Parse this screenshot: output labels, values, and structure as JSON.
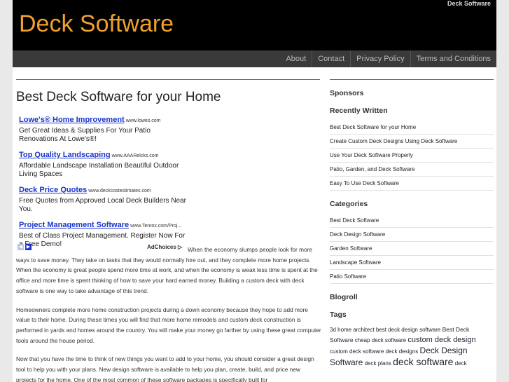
{
  "header": {
    "site_title": "Deck Software",
    "top_label": "Deck Software"
  },
  "nav": [
    "About",
    "Contact",
    "Privacy Policy",
    "Terms and Conditions"
  ],
  "post": {
    "title": "Best Deck Software for your Home"
  },
  "ads": [
    {
      "title": "Lowe's® Home Improvement",
      "url": "www.lowes.com",
      "desc": "Get Great Ideas & Supplies For Your Patio Renovations At Lowe's®!"
    },
    {
      "title": "Top Quality Landscaping",
      "url": "www.AAARelcks.com",
      "desc": "Affordable Landscape Installation Beautiful Outdoor Living Spaces"
    },
    {
      "title": "Deck Price Quotes",
      "url": "www.deckcostestimates.com",
      "desc": "Free Quotes from Approved Local Deck Builders Near You."
    },
    {
      "title": "Project Management Software",
      "url": "www.Tenrox.com/Proj...",
      "desc": "Best of Class Project Management. Register Now For a Free Demo!"
    }
  ],
  "adchoices": "AdChoices ▷",
  "paragraphs": [
    "When the economy slumps people look for more ways to save money. They take on tasks that they would normally hire out, and they complete more home projects. When the economy is great people spend more time at work, and when the economy is weak less time is spent at the office and more time is spent thinking of how to save your hard earned money. Building a custom deck with deck software is one way to take advantage of this trend.",
    "Homeowners complete more home construction projects during a down economy because they hope to add more value to their home. During these times you will find that more home remodels and custom deck construction is performed in yards and homes around the country. You will make your money go farther by using these great computer tools around the house period.",
    "Now that you have the time to think of new things you want to add to your home, you should consider a great design tool to help you with your plans. New design software is available to help you plan, create, build, and price new projects for the home. One of the most common of these software packages is specifically built for"
  ],
  "sidebar": {
    "sponsors_heading": "Sponsors",
    "recent_heading": "Recently Written",
    "recent": [
      "Best Deck Software for your Home",
      "Create Custom Deck Designs Using Deck Software",
      "Use Your Deck Software Properly",
      "Patio, Garden, and Deck Software",
      "Easy To Use Deck Software"
    ],
    "categories_heading": "Categories",
    "categories": [
      "Best Deck Software",
      "Deck Design Software",
      "Garden Software",
      "Landscape Software",
      "Patio Software"
    ],
    "blogroll_heading": "Blogroll",
    "tags_heading": "Tags",
    "tags": [
      {
        "label": "3d home architect",
        "size": "t8"
      },
      {
        "label": "best deck design software",
        "size": "t8"
      },
      {
        "label": "Best Deck Software",
        "size": "t9"
      },
      {
        "label": "cheap deck software",
        "size": "t8"
      },
      {
        "label": "custom deck design",
        "size": "t11"
      },
      {
        "label": "custom deck software",
        "size": "t8"
      },
      {
        "label": "deck designs",
        "size": "t8"
      },
      {
        "label": "Deck Design Software",
        "size": "t12"
      },
      {
        "label": "deck plans",
        "size": "t8"
      },
      {
        "label": "deck software",
        "size": "t14"
      },
      {
        "label": "deck",
        "size": "t8"
      }
    ]
  }
}
